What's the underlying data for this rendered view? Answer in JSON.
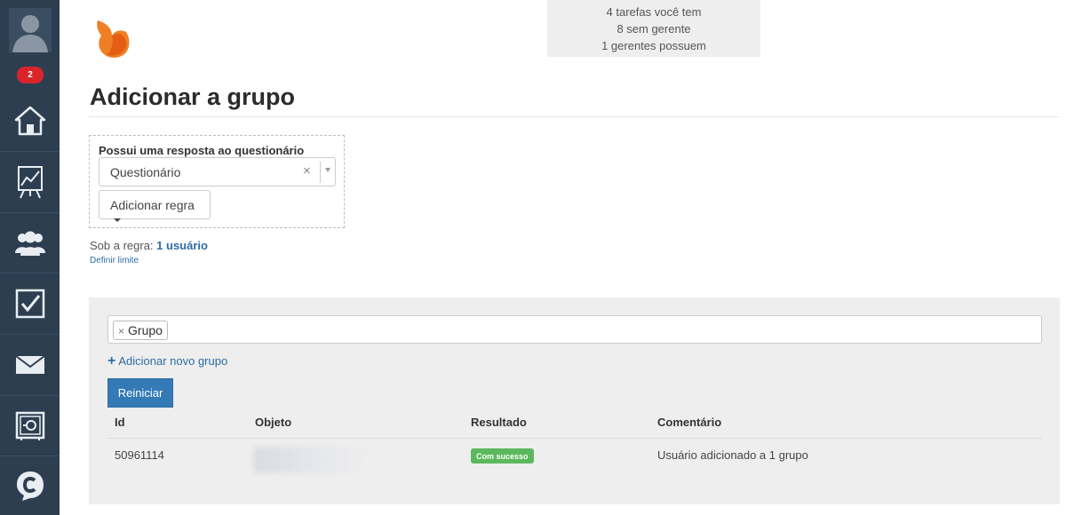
{
  "sidebar": {
    "items": [
      {
        "name": "profile",
        "icon": "user-icon"
      },
      {
        "name": "home",
        "icon": "home-icon"
      },
      {
        "name": "reports",
        "icon": "chart-board-icon"
      },
      {
        "name": "users",
        "icon": "group-icon"
      },
      {
        "name": "tasks",
        "icon": "checkbox-icon"
      },
      {
        "name": "messages",
        "icon": "envelope-icon"
      },
      {
        "name": "safe",
        "icon": "safe-icon"
      },
      {
        "name": "chat",
        "icon": "chat-c-icon"
      }
    ],
    "notification_count": "2",
    "colors": {
      "background": "#2d3e50",
      "badge": "#d9252a"
    }
  },
  "summary": {
    "line1": "4 tarefas você tem",
    "line2": "8 sem gerente",
    "line3": "1 gerentes possuem"
  },
  "page": {
    "title": "Adicionar a grupo"
  },
  "rule_box": {
    "label": "Possui uma resposta ao questionário",
    "select_value": "Questionário",
    "clear_symbol": "×",
    "add_rule_label": "Adicionar regra"
  },
  "under_rule": {
    "prefix": "Sob a regra:",
    "count": "1 usuário",
    "define_limit": "Definir limite"
  },
  "groups": {
    "tags": [
      "Grupo"
    ],
    "tag_remove_symbol": "×",
    "add_new_group": "Adicionar novo grupo",
    "reset_button": "Reiniciar"
  },
  "results_table": {
    "headers": {
      "id": "Id",
      "object": "Objeto",
      "result": "Resultado",
      "comment": "Comentário"
    },
    "rows": [
      {
        "id": "50961114",
        "object": "",
        "result": "Com sucesso",
        "comment": "Usuário adicionado a 1 grupo"
      }
    ],
    "colors": {
      "success": "#5cb85c",
      "link": "#2d6ca2",
      "primary_button": "#337ab7"
    }
  }
}
